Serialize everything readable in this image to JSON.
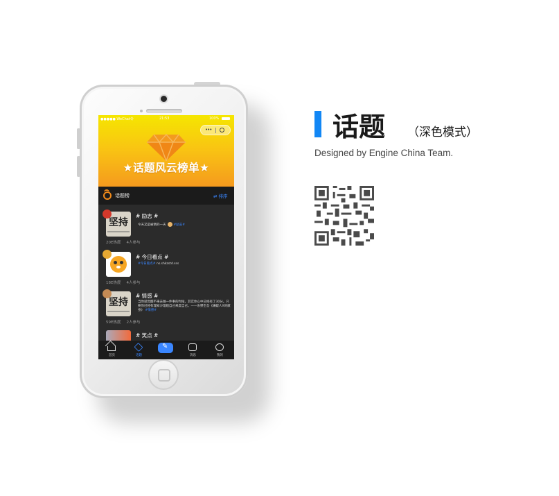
{
  "phone": {
    "status": {
      "carrier": "●●●●● WeChat令",
      "time": "21:53",
      "battery": "100%"
    },
    "banner_title": "★话题风云榜单★",
    "subbar": {
      "label": "话题榜",
      "sort": "⇄ 排序"
    },
    "items": [
      {
        "thumb": "坚持",
        "title": "# 励志 #",
        "desc": "今天又是被倒的一天",
        "link": "#励志#",
        "heat": "20E热度",
        "participants": "4人参与"
      },
      {
        "thumb": "",
        "title": "# 今日看点 #",
        "desc": "",
        "link": "#今日看点#",
        "extra": "ns.shkzstd.sss",
        "heat": "18E热度",
        "participants": "4人参与"
      },
      {
        "thumb": "坚持",
        "title": "# 情感 #",
        "desc": "当你就觉醒不来去做一件事的时候，其实你心中已经有了30分。只要你已经有理知沙理姐自己来度自己。——东野圭吾《嫌疑人X的献身》",
        "link": "#情感#",
        "heat": "59E热度",
        "participants": "2人参与"
      },
      {
        "thumb": "",
        "title": "# 笑点 #",
        "desc": "",
        "link": "",
        "heat": "",
        "participants": ""
      }
    ],
    "tabs": [
      {
        "label": "首页",
        "icon": "home-icon"
      },
      {
        "label": "话题",
        "icon": "diamond-icon",
        "active": true
      },
      {
        "label": "",
        "icon": "pen-icon"
      },
      {
        "label": "消息",
        "icon": "chat-icon"
      },
      {
        "label": "我的",
        "icon": "profile-icon"
      }
    ]
  },
  "heading": {
    "title": "话题",
    "subtitle": "（深色模式）",
    "credit": "Designed by Engine China Team."
  },
  "colors": {
    "accent": "#1287f5",
    "banner_top": "#f5e600",
    "banner_bottom": "#f59a1e",
    "screen_bg": "#2b2b2b",
    "link": "#3a86ff"
  }
}
